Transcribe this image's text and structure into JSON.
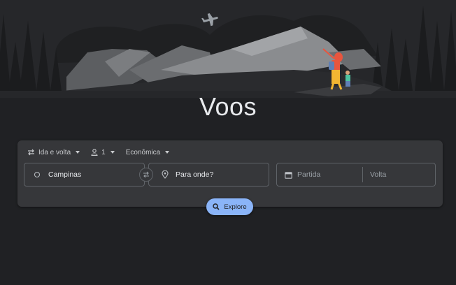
{
  "page": {
    "title": "Voos"
  },
  "search": {
    "trip_type": "Ida e volta",
    "passengers": "1",
    "cabin_class": "Econômica",
    "origin_value": "Campinas",
    "destination_placeholder": "Para onde?",
    "departure_placeholder": "Partida",
    "return_placeholder": "Volta",
    "explore_label": "Explore"
  },
  "colors": {
    "background": "#202124",
    "panel": "#36373a",
    "accent": "#8ab4f8"
  }
}
